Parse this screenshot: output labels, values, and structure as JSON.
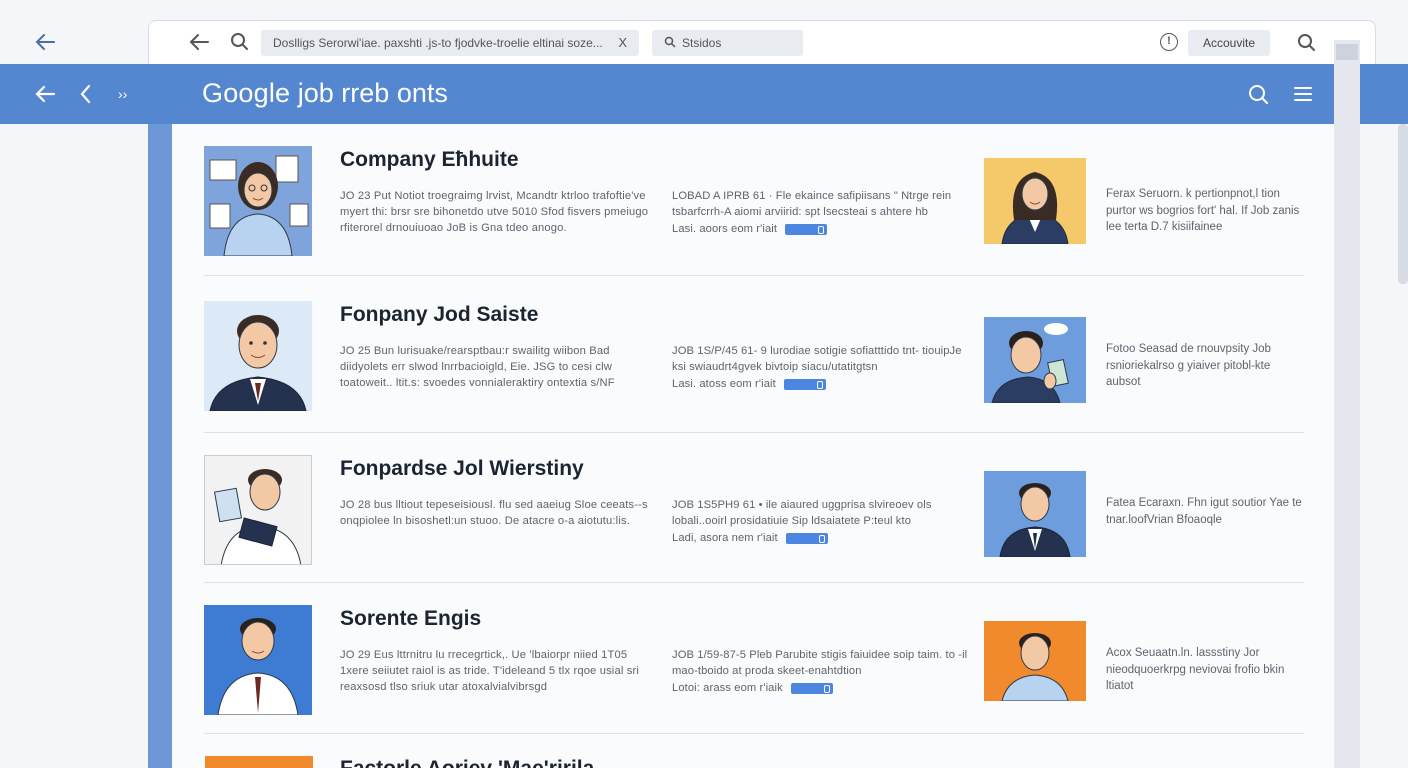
{
  "browser": {
    "url_text": "Doslligs Serorwi'iae. paxshti  .js-to fjodvke-troelie eltinai soze...",
    "url_close": "X",
    "tab_label": "Stsidos",
    "account_label": "Accouvite",
    "info_icon": "info-circle-icon"
  },
  "header": {
    "brand": "Google",
    "title_rest": " job rreb onts",
    "color": "#5487d0",
    "more_glyph": "››"
  },
  "jobs": [
    {
      "title": "Company Eħhuite",
      "desc": "JO  23  Put  Notiot troegraimg  lrvist,  Mcandtr  ktrloo trafoftie've myert  thi: brsr sre bihonetdo utve  5010  Sfod fisvers  pmeiugo rfiterorel drnouiuoao  JoB  is  Gna  tdeo anogo.",
      "meta": "LOBAD  A  IPRB 61  · Fle ekaince safipiisans \" Ntrge rein  tsbarfcrrh-A aiomi arviirid: spt lsecsteai s ahtere hb",
      "meta_last": "Lasi. aoors eom r'iait",
      "side": "Ferax  Seruorn.  k  pertionpnot,l  tion purtor ws bogrios fort' hal.  If  Job zanis lee terta D.7 kisiifainee",
      "avatar_left_bg": "#7ea4db",
      "avatar_right_bg": "#f5c96a"
    },
    {
      "title": "Fonpany Jod Saiste",
      "desc": "JO  25  Bun lurisuake/rearsptbau:r swailitg  wiibon  Bad diidyolets  err  slwod  lnrrbacioigld,  Eie.  JSG  to  cesi  clw toatoweit..  ltit.s:  svoedes  vonnialeraktiry  ontextia  s/NF",
      "meta": "JOB  1S/P/45 61- 9  lurodiae sotigie sofiatttido tnt- tiouipJe ksi swiaudrt4gvek bivtoip siacu/utatitgtsn",
      "meta_last": "Lasi. atoss eom r'iait",
      "side": "Fotoo  Seasad de rnouvpsity  Job rsnioriekalrso g yiaiver pitobl-kte aubsot",
      "avatar_left_bg": "#dce9f7",
      "avatar_right_bg": "#6e9ddd"
    },
    {
      "title": "Fonpardse Jol Wierstiny",
      "desc": "JO  28  bus  lltiout  tepeseisiousl.  flu  sed  aaeiug  Sloe ceeats--s  onqpiolee  ln  bisoshetl:un  stuoo.  De  atacre o-a aiotutu:lis.",
      "meta": "JOB  1S5PH9 61  •  ile aiaured uggprisa slvireoev ols lobali..ooirl prosidatiuie Sip ldsaiatete P:teul kto",
      "meta_last": "Ladi, asora nem r'iait",
      "side": "Fatea  Ecaraxn.  Fhn  igut  soutior Yae te tnar.loofVrian Bfoaoqle",
      "avatar_left_bg": "#f2f2f2",
      "avatar_right_bg": "#6e9ddd"
    },
    {
      "title": "Sorente Engis",
      "desc": "JO  29  Eus  lttrnitru  lu  rrecegrtick,.  Ue  'lbaiorpr  niied 1T05 1xere  seiiutet  raiol  is  as  tride.  T'ideleand  5  tlx rqoe usial  sri reaxsosd  tlso  sriuk  utar  atoxalvialvibrsgd",
      "meta": "JOB  1/59-87-5  Pleb  Parubite  stigis  faiuidee  soip taim. to -il mao-tboido at proda skeet-enahtdtion",
      "meta_last": "Lotoi: arass eom r'iaik",
      "side": "Acox  Seuaatn.ln. lassstiny  Jor nieodquoerkrpg neviovai frofio bkin ltiatot",
      "avatar_left_bg": "#3e7bd2",
      "avatar_right_bg": "#f08a2c"
    }
  ],
  "peek_title": "Factorle Aoriev  'Mae'ririla"
}
